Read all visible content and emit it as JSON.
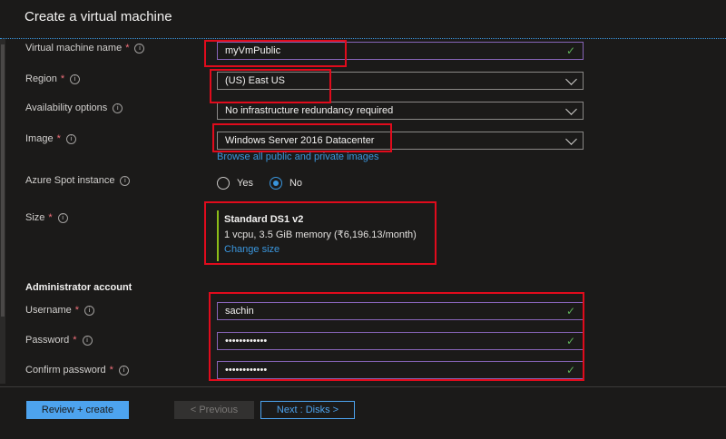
{
  "header": {
    "title": "Create a virtual machine"
  },
  "form": {
    "vm_name": {
      "label": "Virtual machine name",
      "value": "myVmPublic"
    },
    "region": {
      "label": "Region",
      "value": "(US) East US"
    },
    "availability": {
      "label": "Availability options",
      "value": "No infrastructure redundancy required"
    },
    "image": {
      "label": "Image",
      "value": "Windows Server 2016 Datacenter",
      "link": "Browse all public and private images"
    },
    "spot": {
      "label": "Azure Spot instance",
      "yes": "Yes",
      "no": "No",
      "selected": "No"
    },
    "size": {
      "label": "Size",
      "name": "Standard DS1 v2",
      "spec": "1 vcpu, 3.5 GiB memory (₹6,196.13/month)",
      "change": "Change size"
    }
  },
  "admin": {
    "heading": "Administrator account",
    "username": {
      "label": "Username",
      "value": "sachin"
    },
    "password": {
      "label": "Password",
      "value": "••••••••••••"
    },
    "confirm": {
      "label": "Confirm password",
      "value": "••••••••••••"
    }
  },
  "footer": {
    "review": "Review + create",
    "previous": "< Previous",
    "next": "Next : Disks >"
  },
  "colors": {
    "accent": "#3a96dd",
    "valid": "#5fb25a",
    "highlight": "#e00b1c",
    "required": "#f1707b"
  },
  "icons": {
    "info": "info-icon",
    "check": "checkmark-icon",
    "chevron": "chevron-down-icon"
  }
}
